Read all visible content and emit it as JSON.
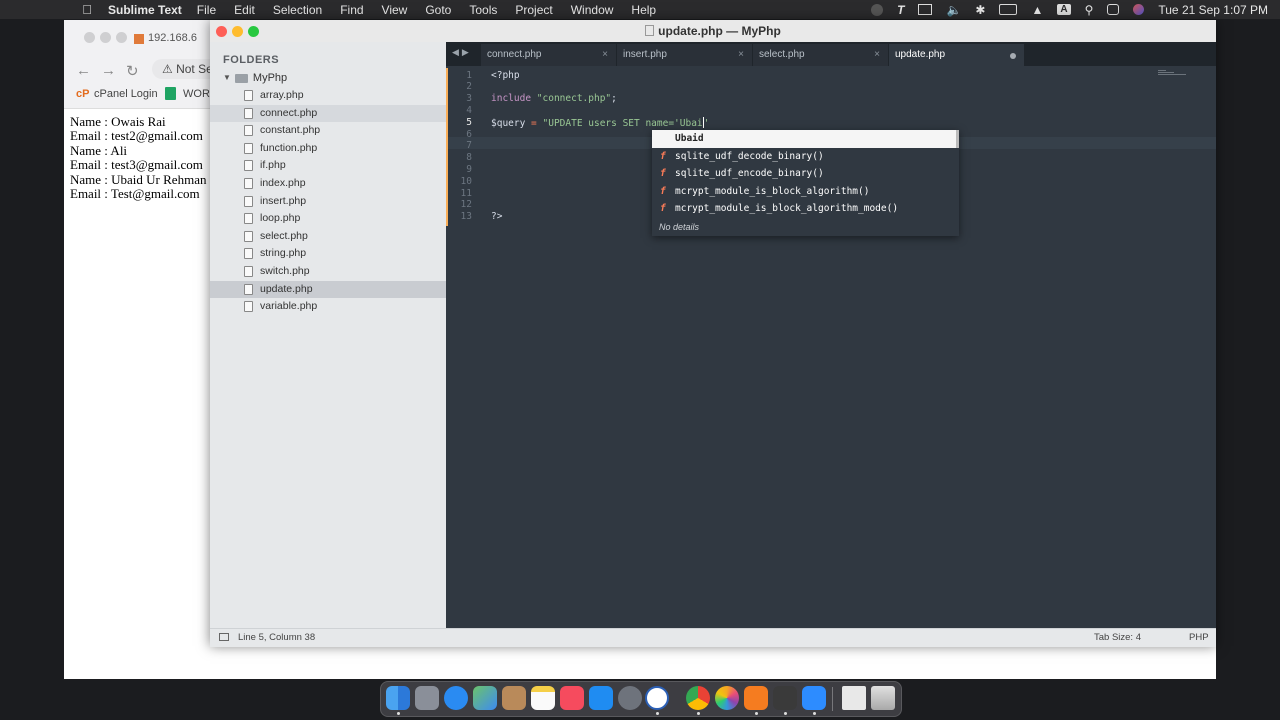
{
  "menubar": {
    "app_name": "Sublime Text",
    "items": [
      "File",
      "Edit",
      "Selection",
      "Find",
      "View",
      "Goto",
      "Tools",
      "Project",
      "Window",
      "Help"
    ],
    "datetime": "Tue 21 Sep  1:07 PM",
    "keyboard_indicator": "A"
  },
  "browser": {
    "tab_title": "192.168.6",
    "address_prefix": "Not Se",
    "bookmarks": [
      "cPanel Login",
      "WORK"
    ],
    "content_lines": [
      "Name : Owais Rai",
      "Email : test2@gmail.com",
      "Name : Ali",
      "Email : test3@gmail.com",
      "Name : Ubaid Ur Rehman",
      "Email : Test@gmail.com"
    ]
  },
  "sublime": {
    "window_title": "update.php — MyPhp",
    "sidebar": {
      "header": "FOLDERS",
      "root_folder": "MyPhp",
      "files": [
        "array.php",
        "connect.php",
        "constant.php",
        "function.php",
        "if.php",
        "index.php",
        "insert.php",
        "loop.php",
        "select.php",
        "string.php",
        "switch.php",
        "update.php",
        "variable.php"
      ],
      "selected": "update.php"
    },
    "tabs": [
      "connect.php",
      "insert.php",
      "select.php",
      "update.php"
    ],
    "active_tab": "update.php",
    "line_numbers": [
      "1",
      "2",
      "3",
      "4",
      "5",
      "6",
      "7",
      "8",
      "9",
      "10",
      "11",
      "12",
      "13"
    ],
    "code": {
      "line1": "<?php",
      "line3_kw": "include",
      "line3_str": "\"connect.php\"",
      "line3_end": ";",
      "line5_var": "$query",
      "line5_op": " = ",
      "line5_str": "\"UPDATE users SET name='Ubai",
      "line5_tail": "'",
      "line13": "?>"
    },
    "autocomplete": {
      "first": "Ubaid",
      "items": [
        {
          "kind": "f",
          "text": "sqlite_udf_decode_binary()"
        },
        {
          "kind": "f",
          "text": "sqlite_udf_encode_binary()"
        },
        {
          "kind": "f",
          "text": "mcrypt_module_is_block_algorithm()"
        },
        {
          "kind": "f",
          "text": "mcrypt_module_is_block_algorithm_mode()"
        }
      ],
      "footer": "No details"
    },
    "status": {
      "position": "Line 5, Column 38",
      "tab_size": "Tab Size: 4",
      "syntax": "PHP"
    }
  },
  "dock": {
    "apps": [
      "finder-icon",
      "launchpad-icon",
      "safari-icon",
      "maps-icon",
      "contacts-icon",
      "notes-icon",
      "music-icon",
      "app-store-icon",
      "system-preferences-icon",
      "word-icon",
      "chrome-icon",
      "photos-icon",
      "xampp-icon",
      "sublime-text-icon",
      "zoom-icon",
      "preview-icon",
      "trash-icon"
    ]
  },
  "colors": {
    "editor_bg": "#303841",
    "sidebar_bg": "#e6e8ea",
    "keyword": "#c695c6",
    "string": "#99c794",
    "operator": "#f97b58",
    "modified_marker": "#f9ae58"
  }
}
